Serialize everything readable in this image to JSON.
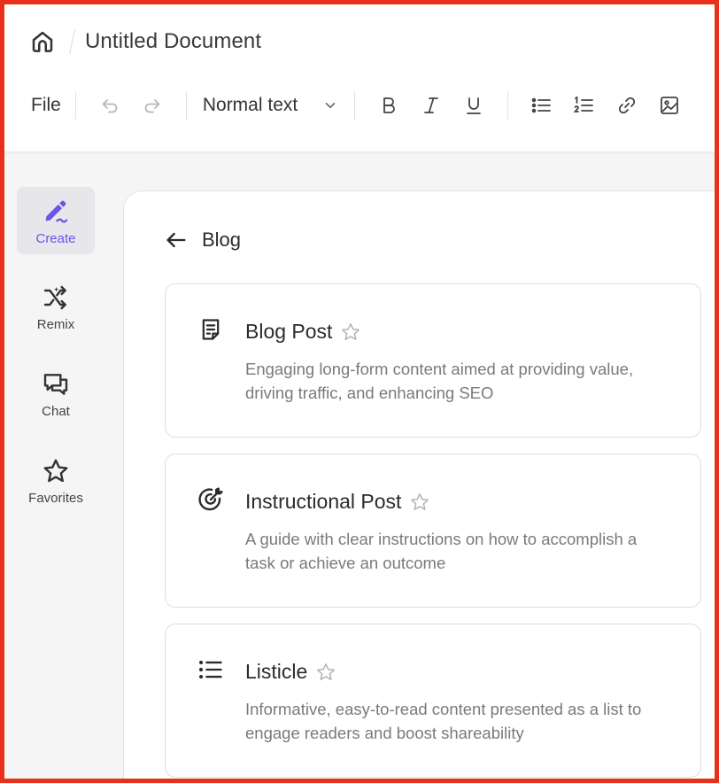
{
  "header": {
    "document_title": "Untitled Document"
  },
  "toolbar": {
    "file_label": "File",
    "text_style": "Normal text"
  },
  "sidebar": {
    "items": [
      {
        "label": "Create",
        "active": true
      },
      {
        "label": "Remix",
        "active": false
      },
      {
        "label": "Chat",
        "active": false
      },
      {
        "label": "Favorites",
        "active": false
      }
    ]
  },
  "main": {
    "back_label": "Blog",
    "cards": [
      {
        "title": "Blog Post",
        "description": "Engaging long-form content aimed at providing value, driving traffic, and enhancing SEO",
        "icon": "document-icon"
      },
      {
        "title": "Instructional Post",
        "description": "A guide with clear instructions on how to accomplish a task or achieve an outcome",
        "icon": "target-icon"
      },
      {
        "title": "Listicle",
        "description": "Informative, easy-to-read content presented as a list to engage readers and boost shareability",
        "icon": "list-icon"
      }
    ]
  },
  "colors": {
    "accent": "#6a55e8",
    "frame_border": "#e8311b"
  }
}
